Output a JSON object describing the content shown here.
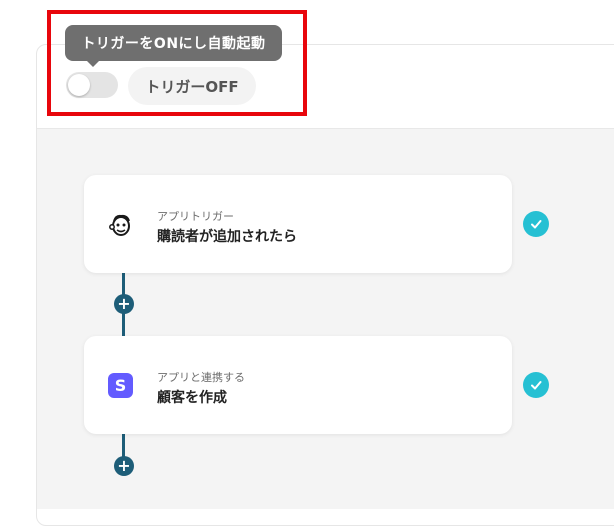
{
  "tooltip": {
    "text": "トリガーをONにし自動起動"
  },
  "trigger": {
    "status_label": "トリガーOFF",
    "enabled": false
  },
  "steps": [
    {
      "kind": "アプリトリガー",
      "title": "購読者が追加されたら",
      "icon": "mailchimp-icon",
      "completed": true
    },
    {
      "kind": "アプリと連携する",
      "title": "顧客を作成",
      "icon": "stripe-icon",
      "badge": "S",
      "completed": true
    }
  ],
  "colors": {
    "highlight": "#e8060c",
    "connector": "#1d5d78",
    "check": "#26c0d3",
    "stripe": "#635bff",
    "tooltip_bg": "#6f6f6f"
  }
}
